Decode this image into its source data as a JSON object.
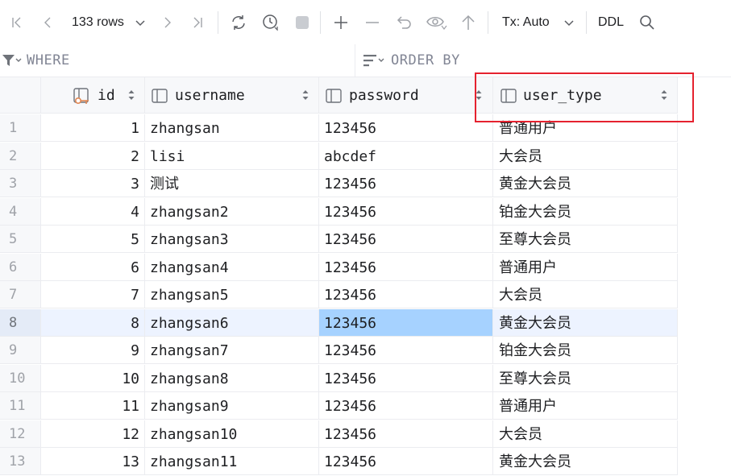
{
  "toolbar": {
    "rows_label": "133 rows",
    "tx_label": "Tx: Auto",
    "ddl_label": "DDL"
  },
  "filter": {
    "where_label": "WHERE",
    "order_by_label": "ORDER BY"
  },
  "columns": [
    {
      "name": "id",
      "type": "key"
    },
    {
      "name": "username",
      "type": "column"
    },
    {
      "name": "password",
      "type": "column"
    },
    {
      "name": "user_type",
      "type": "column"
    }
  ],
  "rows": [
    {
      "rownum": "1",
      "id": "1",
      "username": "zhangsan",
      "password": "123456",
      "user_type": "普通用户"
    },
    {
      "rownum": "2",
      "id": "2",
      "username": "lisi",
      "password": "abcdef",
      "user_type": "大会员"
    },
    {
      "rownum": "3",
      "id": "3",
      "username": "测试",
      "password": "123456",
      "user_type": "黄金大会员"
    },
    {
      "rownum": "4",
      "id": "4",
      "username": "zhangsan2",
      "password": "123456",
      "user_type": "铂金大会员"
    },
    {
      "rownum": "5",
      "id": "5",
      "username": "zhangsan3",
      "password": "123456",
      "user_type": "至尊大会员"
    },
    {
      "rownum": "6",
      "id": "6",
      "username": "zhangsan4",
      "password": "123456",
      "user_type": "普通用户"
    },
    {
      "rownum": "7",
      "id": "7",
      "username": "zhangsan5",
      "password": "123456",
      "user_type": "大会员"
    },
    {
      "rownum": "8",
      "id": "8",
      "username": "zhangsan6",
      "password": "123456",
      "user_type": "黄金大会员"
    },
    {
      "rownum": "9",
      "id": "9",
      "username": "zhangsan7",
      "password": "123456",
      "user_type": "铂金大会员"
    },
    {
      "rownum": "10",
      "id": "10",
      "username": "zhangsan8",
      "password": "123456",
      "user_type": "至尊大会员"
    },
    {
      "rownum": "11",
      "id": "11",
      "username": "zhangsan9",
      "password": "123456",
      "user_type": "普通用户"
    },
    {
      "rownum": "12",
      "id": "12",
      "username": "zhangsan10",
      "password": "123456",
      "user_type": "大会员"
    },
    {
      "rownum": "13",
      "id": "13",
      "username": "zhangsan11",
      "password": "123456",
      "user_type": "黄金大会员"
    }
  ],
  "selection": {
    "row": 8,
    "column": "password"
  },
  "colors": {
    "accent": "#3574f0",
    "highlight_box": "#e5222f",
    "selected_cell": "#a6d2ff",
    "current_row": "#edf3ff"
  }
}
